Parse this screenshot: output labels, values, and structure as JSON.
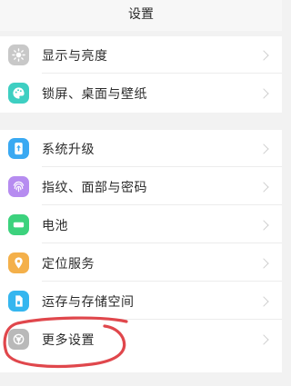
{
  "header": {
    "title": "设置"
  },
  "group1": {
    "items": [
      {
        "label": "显示与亮度",
        "icon": "brightness-icon",
        "color": "#c8c8c8"
      },
      {
        "label": "锁屏、桌面与壁纸",
        "icon": "palette-icon",
        "color": "#3ecfc2"
      }
    ]
  },
  "group2": {
    "items": [
      {
        "label": "系统升级",
        "icon": "system-update-icon",
        "color": "#3aa9f2"
      },
      {
        "label": "指纹、面部与密码",
        "icon": "fingerprint-icon",
        "color": "#b68cf0"
      },
      {
        "label": "电池",
        "icon": "battery-icon",
        "color": "#3cd27d"
      },
      {
        "label": "定位服务",
        "icon": "location-icon",
        "color": "#f4b04a"
      },
      {
        "label": "运存与存储空间",
        "icon": "storage-icon",
        "color": "#35b6ef"
      },
      {
        "label": "更多设置",
        "icon": "more-settings-icon",
        "color": "#b9b9b9"
      }
    ]
  },
  "annotation": {
    "color": "#e0474c"
  }
}
